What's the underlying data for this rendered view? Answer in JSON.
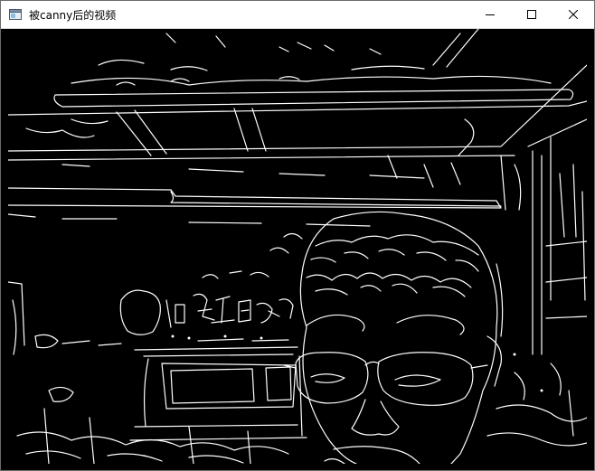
{
  "window": {
    "title": "被canny后的视频"
  },
  "caption_buttons": [
    {
      "name": "minimize-button",
      "icon": "minimize-icon"
    },
    {
      "name": "maximize-button",
      "icon": "maximize-icon"
    },
    {
      "name": "close-button",
      "icon": "close-icon"
    }
  ],
  "video": {
    "kind": "canny-edge-detected webcam frame",
    "background_color": "#000000",
    "edge_color": "#ffffff"
  }
}
